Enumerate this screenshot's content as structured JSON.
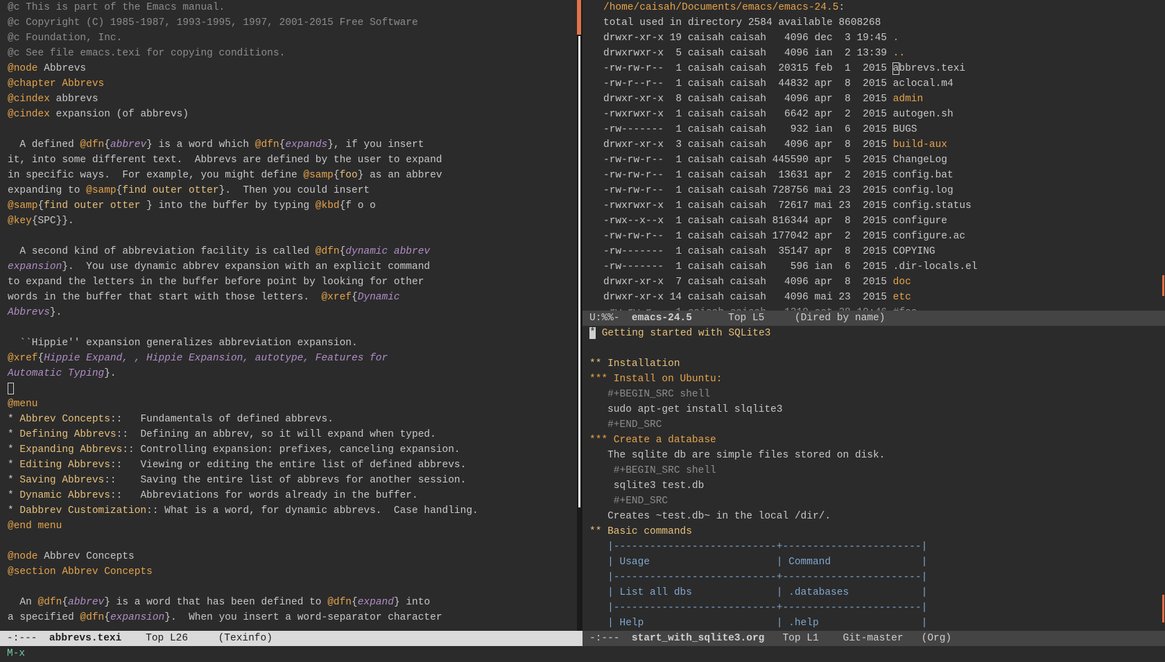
{
  "left": {
    "modeline": {
      "status": "-:---",
      "buffer": "abbrevs.texi",
      "position": "Top L26",
      "mode": "(Texinfo)"
    }
  },
  "right_top": {
    "modeline": {
      "status": "U:%%-",
      "buffer": "emacs-24.5",
      "position": "Top L5",
      "mode": "(Dired by name)"
    },
    "path": "/home/caisah/Documents/emacs/emacs-24.5",
    "total": "total used in directory 2584 available 8608268",
    "entries": [
      {
        "perms": "drwxr-xr-x",
        "links": "19",
        "owner": "caisah",
        "group": "caisah",
        "size": "4096",
        "month": "dec",
        "day": "3",
        "time": "19:45",
        "name": ".",
        "dir": true
      },
      {
        "perms": "drwxrwxr-x",
        "links": "5",
        "owner": "caisah",
        "group": "caisah",
        "size": "4096",
        "month": "ian",
        "day": "2",
        "time": "13:39",
        "name": "..",
        "dir": true
      },
      {
        "perms": "-rw-rw-r--",
        "links": "1",
        "owner": "caisah",
        "group": "caisah",
        "size": "20315",
        "month": "feb",
        "day": "1",
        "time": "2015",
        "name": "abbrevs.texi",
        "dir": false,
        "cursor": true
      },
      {
        "perms": "-rw-r--r--",
        "links": "1",
        "owner": "caisah",
        "group": "caisah",
        "size": "44832",
        "month": "apr",
        "day": "8",
        "time": "2015",
        "name": "aclocal.m4",
        "dir": false
      },
      {
        "perms": "drwxr-xr-x",
        "links": "8",
        "owner": "caisah",
        "group": "caisah",
        "size": "4096",
        "month": "apr",
        "day": "8",
        "time": "2015",
        "name": "admin",
        "dir": true
      },
      {
        "perms": "-rwxrwxr-x",
        "links": "1",
        "owner": "caisah",
        "group": "caisah",
        "size": "6642",
        "month": "apr",
        "day": "2",
        "time": "2015",
        "name": "autogen.sh",
        "dir": false
      },
      {
        "perms": "-rw-------",
        "links": "1",
        "owner": "caisah",
        "group": "caisah",
        "size": "932",
        "month": "ian",
        "day": "6",
        "time": "2015",
        "name": "BUGS",
        "dir": false
      },
      {
        "perms": "drwxr-xr-x",
        "links": "3",
        "owner": "caisah",
        "group": "caisah",
        "size": "4096",
        "month": "apr",
        "day": "8",
        "time": "2015",
        "name": "build-aux",
        "dir": true
      },
      {
        "perms": "-rw-rw-r--",
        "links": "1",
        "owner": "caisah",
        "group": "caisah",
        "size": "445590",
        "month": "apr",
        "day": "5",
        "time": "2015",
        "name": "ChangeLog",
        "dir": false
      },
      {
        "perms": "-rw-rw-r--",
        "links": "1",
        "owner": "caisah",
        "group": "caisah",
        "size": "13631",
        "month": "apr",
        "day": "2",
        "time": "2015",
        "name": "config.bat",
        "dir": false
      },
      {
        "perms": "-rw-rw-r--",
        "links": "1",
        "owner": "caisah",
        "group": "caisah",
        "size": "728756",
        "month": "mai",
        "day": "23",
        "time": "2015",
        "name": "config.log",
        "dir": false
      },
      {
        "perms": "-rwxrwxr-x",
        "links": "1",
        "owner": "caisah",
        "group": "caisah",
        "size": "72617",
        "month": "mai",
        "day": "23",
        "time": "2015",
        "name": "config.status",
        "dir": false
      },
      {
        "perms": "-rwx--x--x",
        "links": "1",
        "owner": "caisah",
        "group": "caisah",
        "size": "816344",
        "month": "apr",
        "day": "8",
        "time": "2015",
        "name": "configure",
        "dir": false
      },
      {
        "perms": "-rw-rw-r--",
        "links": "1",
        "owner": "caisah",
        "group": "caisah",
        "size": "177042",
        "month": "apr",
        "day": "2",
        "time": "2015",
        "name": "configure.ac",
        "dir": false
      },
      {
        "perms": "-rw-------",
        "links": "1",
        "owner": "caisah",
        "group": "caisah",
        "size": "35147",
        "month": "apr",
        "day": "8",
        "time": "2015",
        "name": "COPYING",
        "dir": false
      },
      {
        "perms": "-rw-------",
        "links": "1",
        "owner": "caisah",
        "group": "caisah",
        "size": "596",
        "month": "ian",
        "day": "6",
        "time": "2015",
        "name": ".dir-locals.el",
        "dir": false
      },
      {
        "perms": "drwxr-xr-x",
        "links": "7",
        "owner": "caisah",
        "group": "caisah",
        "size": "4096",
        "month": "apr",
        "day": "8",
        "time": "2015",
        "name": "doc",
        "dir": true
      },
      {
        "perms": "drwxr-xr-x",
        "links": "14",
        "owner": "caisah",
        "group": "caisah",
        "size": "4096",
        "month": "mai",
        "day": "23",
        "time": "2015",
        "name": "etc",
        "dir": true
      }
    ]
  },
  "right_bottom": {
    "modeline": {
      "status": "-:---",
      "buffer": "start_with_sqlite3.org",
      "position": "Top L1",
      "vc": "Git-master",
      "mode": "(Org)"
    },
    "lines": [
      {
        "cls": "org1",
        "text": "Getting started with SQLite3",
        "bullet": "*"
      },
      {
        "cls": "",
        "text": ""
      },
      {
        "cls": "org1",
        "text": "** Installation"
      },
      {
        "cls": "org3",
        "text": "*** Install on Ubuntu:"
      },
      {
        "cls": "orgmeta",
        "text": "   #+BEGIN_SRC shell"
      },
      {
        "cls": "",
        "text": "   sudo apt-get install slqlite3"
      },
      {
        "cls": "orgmeta",
        "text": "   #+END_SRC"
      },
      {
        "cls": "org3",
        "text": "*** Create a database"
      },
      {
        "cls": "",
        "text": "   The sqlite db are simple files stored on disk."
      },
      {
        "cls": "orgmeta",
        "text": "    #+BEGIN_SRC shell"
      },
      {
        "cls": "",
        "text": "    sqlite3 test.db"
      },
      {
        "cls": "orgmeta",
        "text": "    #+END_SRC"
      },
      {
        "cls": "",
        "text": "   Creates ~test.db~ in the local /dir/."
      },
      {
        "cls": "org1",
        "text": "** Basic commands"
      },
      {
        "cls": "orgtbl",
        "text": "   |---------------------------+-----------------------|"
      },
      {
        "cls": "orgtbl",
        "text": "   | Usage                     | Command               |"
      },
      {
        "cls": "orgtbl",
        "text": "   |---------------------------+-----------------------|"
      },
      {
        "cls": "orgtbl",
        "text": "   | List all dbs              | .databases            |"
      },
      {
        "cls": "orgtbl",
        "text": "   |---------------------------+-----------------------|"
      },
      {
        "cls": "orgtbl",
        "text": "   | Help                      | .help                 |"
      }
    ]
  },
  "minibuffer": "M-x"
}
